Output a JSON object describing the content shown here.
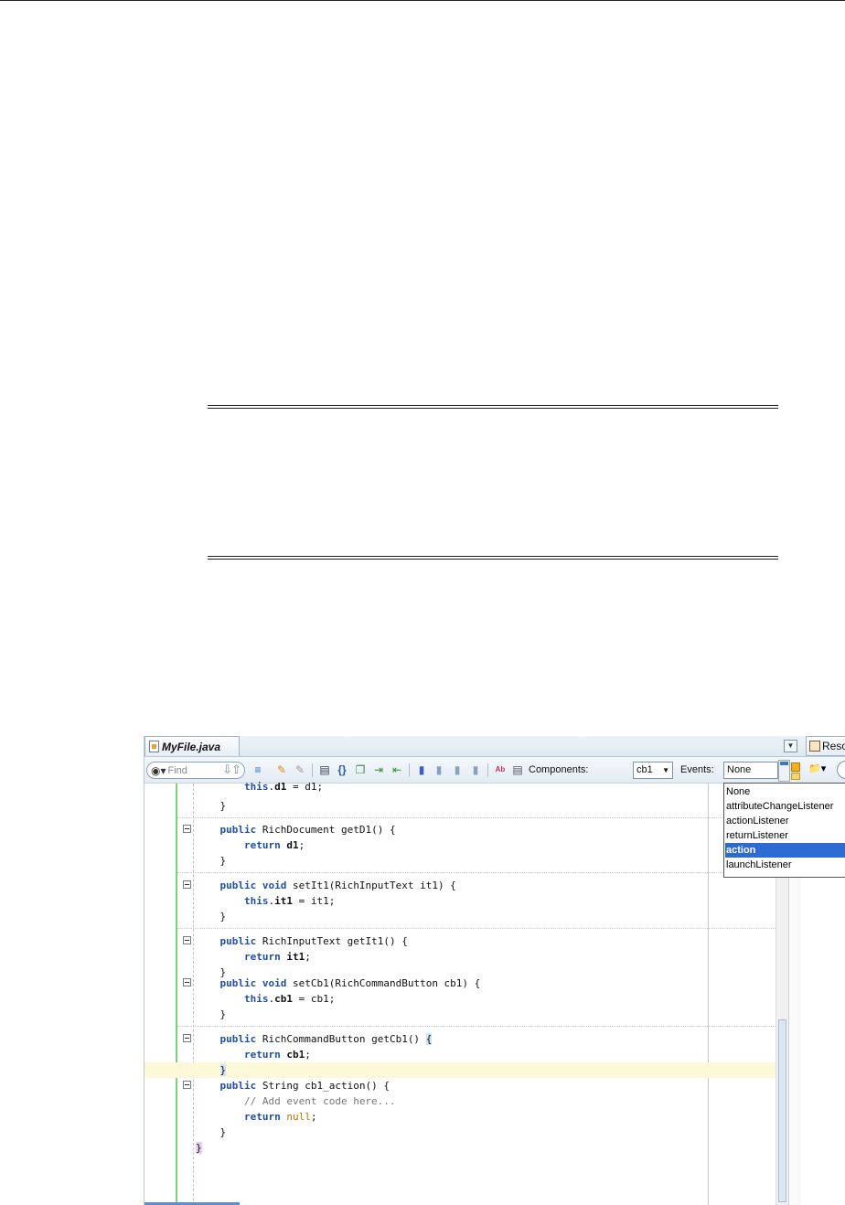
{
  "editor_tab": {
    "filename": "MyFile.java"
  },
  "side_tab": {
    "label": "Reso"
  },
  "toolbar": {
    "find_placeholder": "Find",
    "components_label": "Components:",
    "components_value": "cb1",
    "events_label": "Events:",
    "events_value": "None"
  },
  "events_dropdown": {
    "options": [
      "None",
      "attributeChangeListener",
      "actionListener",
      "returnListener",
      "action",
      "launchListener"
    ],
    "selected": "action"
  },
  "code": {
    "l0": "this.d1 = d1;",
    "l1": "}",
    "l2": "public RichDocument getD1() {",
    "l3": "return d1;",
    "l4": "}",
    "l5": "public void setIt1(RichInputText it1) {",
    "l6": "this.it1 = it1;",
    "l7": "}",
    "l8": "public RichInputText getIt1() {",
    "l9": "return it1;",
    "l10": "}",
    "l11": "public void setCb1(RichCommandButton cb1) {",
    "l12": "this.cb1 = cb1;",
    "l13": "}",
    "l14": "public RichCommandButton getCb1() {",
    "l15": "return cb1;",
    "l16": "}",
    "l17": "public String cb1_action() {",
    "l18": "// Add event code here...",
    "l19": "return null;",
    "l20": "}",
    "l21": "}"
  },
  "icons": [
    "binoculars-icon",
    "down-arrow-icon",
    "up-arrow-icon",
    "highlight-icon",
    "clear-highlight-icon",
    "toggle-line-numbers-icon",
    "braces-icon",
    "copy-icon",
    "indent-icon",
    "unindent-icon",
    "bookmark-icon",
    "prev-bookmark-icon",
    "next-bookmark-icon",
    "clear-bookmarks-icon",
    "spelling-icon",
    "template-icon",
    "new-icon"
  ]
}
